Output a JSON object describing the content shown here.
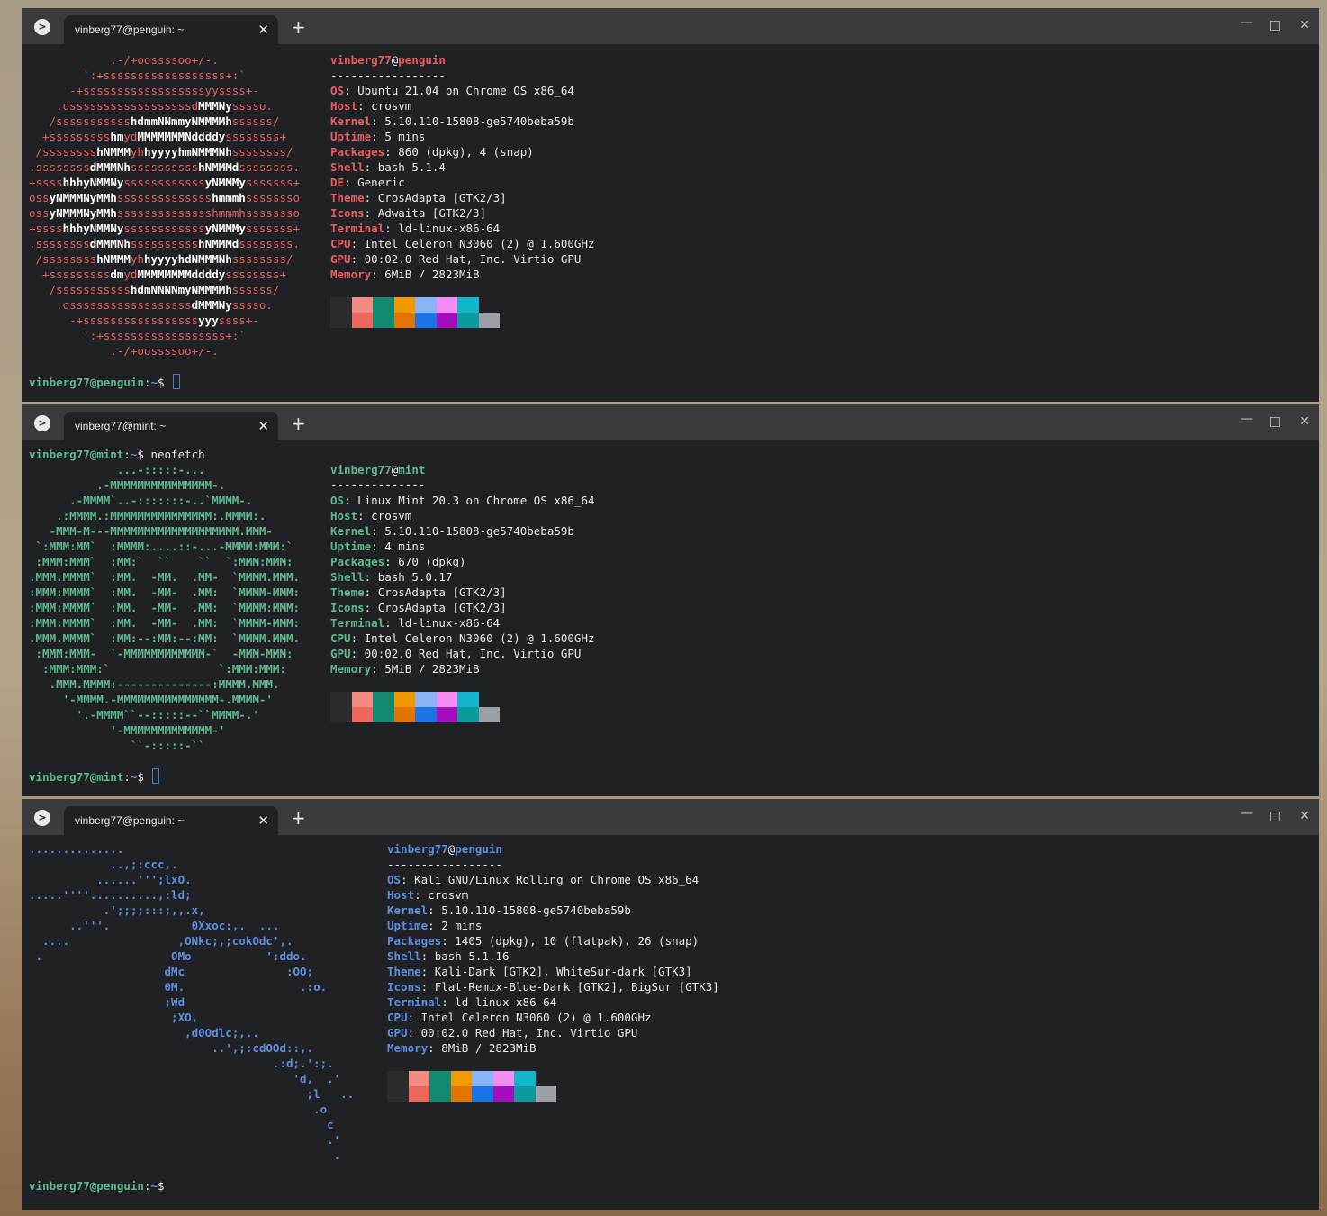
{
  "colors": {
    "ubuntu_red": "#e95f5f",
    "mint_green": "#5fb890",
    "kali_blue": "#5f8fe0",
    "text": "#e8eaed"
  },
  "windows": [
    {
      "tab_title": "vinberg77@penguin: ~",
      "accent": "#e95f5f",
      "prompt_user": "vinberg77@penguin",
      "prompt_path": "~",
      "prompt_symbol": "$",
      "command": "",
      "logo": [
        [
          "            .-/+oossssoo+/-.",
          ""
        ],
        [
          "        `:+ssssssssssssssssss+:`",
          ""
        ],
        [
          "      -+ssssssssssssssssssyyssss+-",
          ""
        ],
        [
          "    .ossssssssssssssssssd",
          "MMMNy",
          "sssso."
        ],
        [
          "   /sssssssssss",
          "hdmmNNmmyNMMMMh",
          "ssssss/"
        ],
        [
          "  +sssssssss",
          "hm",
          "yd",
          "MMMMMMMNddddy",
          "ssssssss+"
        ],
        [
          " /ssssssss",
          "hNMMM",
          "yh",
          "hyyyyhmNMMMNh",
          "ssssssss/"
        ],
        [
          ".ssssssss",
          "dMMMNh",
          "ssssssssss",
          "hNMMMd",
          "ssssssss."
        ],
        [
          "+ssss",
          "hhhyNMMNy",
          "ssssssssssss",
          "yNMMMy",
          "sssssss+"
        ],
        [
          "oss",
          "yNMMMNyMMh",
          "ssssssssssssss",
          "hmmmh",
          "ssssssso"
        ],
        [
          "oss",
          "yNMMMNyMMh",
          "sssssssssssssshmmmhssssssso"
        ],
        [
          "+ssss",
          "hhhyNMMNy",
          "ssssssssssss",
          "yNMMMy",
          "sssssss+"
        ],
        [
          ".ssssssss",
          "dMMMNh",
          "ssssssssss",
          "hNMMMd",
          "ssssssss."
        ],
        [
          " /ssssssss",
          "hNMMM",
          "yh",
          "hyyyyhdNMMMNh",
          "ssssssss/"
        ],
        [
          "  +sssssssss",
          "dm",
          "yd",
          "MMMMMMMMddddy",
          "ssssssss+"
        ],
        [
          "   /sssssssssss",
          "hdmNNNNmyNMMMMh",
          "ssssss/"
        ],
        [
          "    .ossssssssssssssssss",
          "dMMMNy",
          "sssso."
        ],
        [
          "      -+sssssssssssssssss",
          "yyy",
          "ssss+-"
        ],
        [
          "        `:+ssssssssssssssssss+:`",
          ""
        ],
        [
          "            .-/+oossssoo+/-.",
          ""
        ]
      ],
      "info_user": "vinberg77",
      "info_host": "penguin",
      "separator": "-----------------",
      "info": [
        [
          "OS",
          "Ubuntu 21.04 on Chrome OS x86_64"
        ],
        [
          "Host",
          "crosvm"
        ],
        [
          "Kernel",
          "5.10.110-15808-ge5740beba59b"
        ],
        [
          "Uptime",
          "5 mins"
        ],
        [
          "Packages",
          "860 (dpkg), 4 (snap)"
        ],
        [
          "Shell",
          "bash 5.1.4"
        ],
        [
          "DE",
          "Generic"
        ],
        [
          "Theme",
          "CrosAdapta [GTK2/3]"
        ],
        [
          "Icons",
          "Adwaita [GTK2/3]"
        ],
        [
          "Terminal",
          "ld-linux-x86-64"
        ],
        [
          "CPU",
          "Intel Celeron N3060 (2) @ 1.600GHz"
        ],
        [
          "GPU",
          "00:02.0 Red Hat, Inc. Virtio GPU"
        ],
        [
          "Memory",
          "6MiB / 2823MiB"
        ]
      ]
    },
    {
      "tab_title": "vinberg77@mint: ~",
      "accent": "#5fb890",
      "prompt_user": "vinberg77@mint",
      "prompt_path": "~",
      "prompt_symbol": "$",
      "command": "neofetch",
      "logo_lines": [
        "             ...-:::::-...",
        "          .-MMMMMMMMMMMMMMM-.",
        "      .-MMMM`..-:::::::-..`MMMM-.",
        "    .:MMMM.:MMMMMMMMMMMMMMM:.MMMM:.",
        "   -MMM-M---MMMMMMMMMMMMMMMMMMM.MMM-",
        " `:MMM:MM`  :MMMM:....::-...-MMMM:MMM:`",
        " :MMM:MMM`  :MM:`  ``    ``  `:MMM:MMM:",
        ".MMM.MMMM`  :MM.  -MM.  .MM-  `MMMM.MMM.",
        ":MMM:MMMM`  :MM.  -MM-  .MM:  `MMMM-MMM:",
        ":MMM:MMMM`  :MM.  -MM-  .MM:  `MMMM:MMM:",
        ":MMM:MMMM`  :MM.  -MM-  .MM:  `MMMM-MMM:",
        ".MMM.MMMM`  :MM:--:MM:--:MM:  `MMMM.MMM.",
        " :MMM:MMM-  `-MMMMMMMMMMMM-`  -MMM-MMM:",
        "  :MMM:MMM:`                `:MMM:MMM:",
        "   .MMM.MMMM:--------------:MMMM.MMM.",
        "     '-MMMM.-MMMMMMMMMMMMMMM-.MMMM-'",
        "       '.-MMMM``--:::::--``MMMM-.'",
        "            '-MMMMMMMMMMMMM-'",
        "               ``-:::::-``"
      ],
      "info_user": "vinberg77",
      "info_host": "mint",
      "separator": "--------------",
      "info": [
        [
          "OS",
          "Linux Mint 20.3 on Chrome OS x86_64"
        ],
        [
          "Host",
          "crosvm"
        ],
        [
          "Kernel",
          "5.10.110-15808-ge5740beba59b"
        ],
        [
          "Uptime",
          "4 mins"
        ],
        [
          "Packages",
          "670 (dpkg)"
        ],
        [
          "Shell",
          "bash 5.0.17"
        ],
        [
          "Theme",
          "CrosAdapta [GTK2/3]"
        ],
        [
          "Icons",
          "CrosAdapta [GTK2/3]"
        ],
        [
          "Terminal",
          "ld-linux-x86-64"
        ],
        [
          "CPU",
          "Intel Celeron N3060 (2) @ 1.600GHz"
        ],
        [
          "GPU",
          "00:02.0 Red Hat, Inc. Virtio GPU"
        ],
        [
          "Memory",
          "5MiB / 2823MiB"
        ]
      ]
    },
    {
      "tab_title": "vinberg77@penguin: ~",
      "accent": "#5f8fe0",
      "prompt_user": "vinberg77@penguin",
      "prompt_path": "~",
      "prompt_symbol": "$",
      "command": "",
      "logo_lines": [
        "..............",
        "            ..,;:ccc,.",
        "          ......''';lxO.",
        ".....''''..........,:ld;",
        "           .';;;;:::;,,.x,",
        "      ..'''.            0Xxoc:,.  ...",
        "  ....                ,ONkc;,;cokOdc',.",
        " .                   OMo           ':ddo.",
        "                    dMc               :OO;",
        "                    0M.                 .:o.",
        "                    ;Wd",
        "                     ;XO,",
        "                       ,d0Odlc;,..",
        "                           ..',;:cdOOd::,.",
        "                                    .:d;.':;.",
        "                                       'd,  .'",
        "                                         ;l   ..",
        "                                          .o",
        "                                            c",
        "                                            .'",
        "                                             ."
      ],
      "info_user": "vinberg77",
      "info_host": "penguin",
      "separator": "-----------------",
      "info": [
        [
          "OS",
          "Kali GNU/Linux Rolling on Chrome OS x86_64"
        ],
        [
          "Host",
          "crosvm"
        ],
        [
          "Kernel",
          "5.10.110-15808-ge5740beba59b"
        ],
        [
          "Uptime",
          "2 mins"
        ],
        [
          "Packages",
          "1405 (dpkg), 10 (flatpak), 26 (snap)"
        ],
        [
          "Shell",
          "bash 5.1.16"
        ],
        [
          "Theme",
          "Kali-Dark [GTK2], WhiteSur-dark [GTK3]"
        ],
        [
          "Icons",
          "Flat-Remix-Blue-Dark [GTK2], BigSur [GTK3]"
        ],
        [
          "Terminal",
          "ld-linux-x86-64"
        ],
        [
          "CPU",
          "Intel Celeron N3060 (2) @ 1.600GHz"
        ],
        [
          "GPU",
          "00:02.0 Red Hat, Inc. Virtio GPU"
        ],
        [
          "Memory",
          "8MiB / 2823MiB"
        ]
      ]
    }
  ],
  "palette_top": [
    "#2a2b2e",
    "#f28b82",
    "#128a72",
    "#f29900",
    "#8ab4f8",
    "#f48cf4",
    "#12b5cb",
    "#202124"
  ],
  "palette_bottom": [
    "#2a2b2e",
    "#ee675c",
    "#128a72",
    "#e37400",
    "#1a73e8",
    "#a50ebc",
    "#0b9a9e",
    "#9aa0a6"
  ],
  "window_controls": {
    "minimize_glyph": "—",
    "maximize_glyph": "□",
    "close_glyph": "✕",
    "tab_close_glyph": "✕",
    "new_tab_glyph": "+",
    "app_icon_glyph": ">"
  }
}
